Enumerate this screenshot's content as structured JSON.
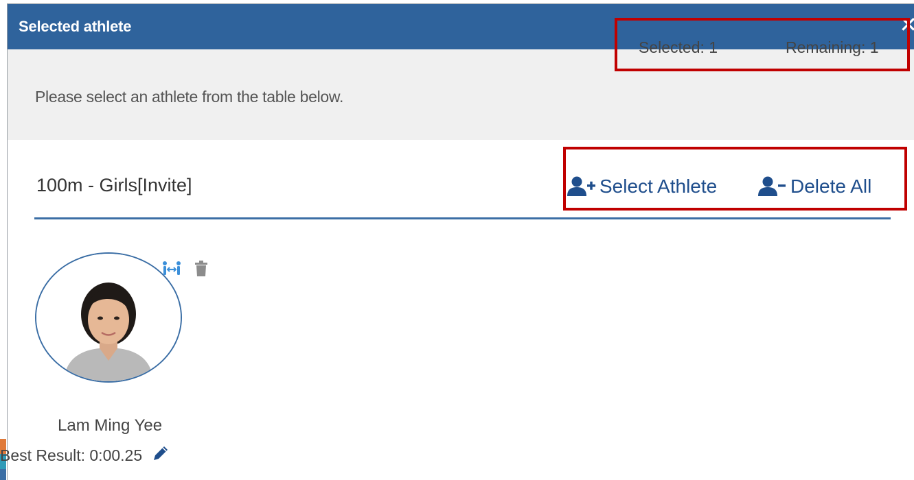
{
  "dialog": {
    "title": "Selected athlete",
    "close_glyph": "✕"
  },
  "info": {
    "message": "Please select an athlete from the table below.",
    "selected_label": "Selected: 1",
    "remaining_label": "Remaining: 1"
  },
  "event": {
    "title": "100m - Girls[Invite]"
  },
  "actions": {
    "select_label": "Select Athlete",
    "delete_label": "Delete All",
    "select_icon": "user-plus-icon",
    "delete_icon": "user-minus-icon"
  },
  "athlete": {
    "name": "Lam Ming Yee",
    "best_result": "Best Result: 0:00.25",
    "icons": [
      "swap-icon",
      "trash-icon",
      "pencil-icon"
    ]
  },
  "colors": {
    "header_bg": "#2f639c",
    "info_bg": "#f0f0f0",
    "accent": "#1f4e8c",
    "highlight_border": "#c00000",
    "swap_icon": "#3b8fd9",
    "trash_icon": "#8c8c8c"
  }
}
